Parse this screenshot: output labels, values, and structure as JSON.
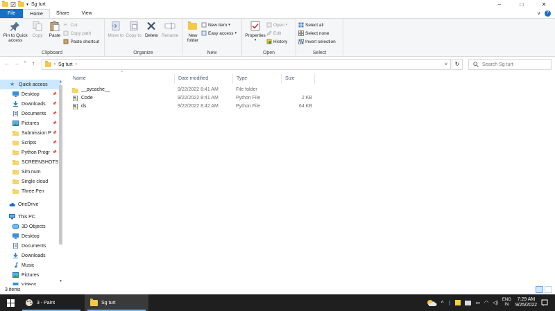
{
  "window": {
    "title": "Sg turt",
    "controls": {
      "minimize": "–",
      "maximize": "□",
      "close": "✕"
    },
    "tabs": {
      "file": "File",
      "home": "Home",
      "share": "Share",
      "view": "View"
    },
    "expand": "˅",
    "help": "?"
  },
  "ribbon": {
    "clipboard": {
      "label": "Clipboard",
      "pin": "Pin to Quick access",
      "copy": "Copy",
      "paste": "Paste",
      "cut": "Cut",
      "copy_path": "Copy path",
      "paste_shortcut": "Paste shortcut"
    },
    "organize": {
      "label": "Organize",
      "move_to": "Move to",
      "copy_to": "Copy to",
      "delete": "Delete",
      "rename": "Rename"
    },
    "new": {
      "label": "New",
      "new_folder": "New folder",
      "new_item": "New item",
      "easy_access": "Easy access"
    },
    "open": {
      "label": "Open",
      "properties": "Properties",
      "open": "Open",
      "edit": "Edit",
      "history": "History"
    },
    "select": {
      "label": "Select",
      "select_all": "Select all",
      "select_none": "Select none",
      "invert": "Invert selection"
    }
  },
  "address": {
    "path": "Sg turt",
    "search_placeholder": "Search Sg turt"
  },
  "nav": {
    "quick_access": "Quick access",
    "quick_items": [
      {
        "label": "Desktop",
        "pinned": true,
        "icon": "desktop-icon"
      },
      {
        "label": "Downloads",
        "pinned": true,
        "icon": "download-icon"
      },
      {
        "label": "Documents",
        "pinned": true,
        "icon": "document-icon"
      },
      {
        "label": "Pictures",
        "pinned": true,
        "icon": "picture-icon"
      },
      {
        "label": "Submission P",
        "pinned": true,
        "icon": "folder-icon"
      },
      {
        "label": "Scripts",
        "pinned": true,
        "icon": "folder-icon"
      },
      {
        "label": "Python Progr",
        "pinned": true,
        "icon": "folder-icon"
      },
      {
        "label": "SCREENSHOTS",
        "pinned": false,
        "icon": "folder-icon"
      },
      {
        "label": "Sim num",
        "pinned": false,
        "icon": "folder-icon"
      },
      {
        "label": "Single cloud",
        "pinned": false,
        "icon": "folder-icon"
      },
      {
        "label": "Three Pen",
        "pinned": false,
        "icon": "folder-icon"
      }
    ],
    "onedrive": "OneDrive",
    "this_pc": "This PC",
    "pc_items": [
      {
        "label": "3D Objects",
        "icon": "cube-icon"
      },
      {
        "label": "Desktop",
        "icon": "desktop-icon"
      },
      {
        "label": "Documents",
        "icon": "document-icon"
      },
      {
        "label": "Downloads",
        "icon": "download-icon"
      },
      {
        "label": "Music",
        "icon": "music-icon"
      },
      {
        "label": "Pictures",
        "icon": "picture-icon"
      },
      {
        "label": "Videos",
        "icon": "video-icon"
      }
    ]
  },
  "columns": {
    "name": "Name",
    "date": "Date modified",
    "type": "Type",
    "size": "Size"
  },
  "files": [
    {
      "name": "__pycache__",
      "date": "9/22/2022 8:41 AM",
      "type": "File folder",
      "size": "",
      "icon": "folder-icon"
    },
    {
      "name": "Code",
      "date": "9/22/2022 8:41 AM",
      "type": "Python File",
      "size": "2 KB",
      "icon": "python-file-icon"
    },
    {
      "name": "ds",
      "date": "9/22/2022 8:42 AM",
      "type": "Python File",
      "size": "64 KB",
      "icon": "python-file-icon"
    }
  ],
  "status": {
    "count": "3 items"
  },
  "taskbar": {
    "paint": "3 - Paint",
    "explorer": "Sg turt",
    "lang_top": "ENG",
    "lang_bottom": "IN",
    "time": "7:29 AM",
    "date": "9/25/2022"
  },
  "colors": {
    "accent": "#1a6ec6",
    "folder": "#f4c94a",
    "selection": "#cce8ff",
    "taskbar": "#1f1f1f"
  }
}
